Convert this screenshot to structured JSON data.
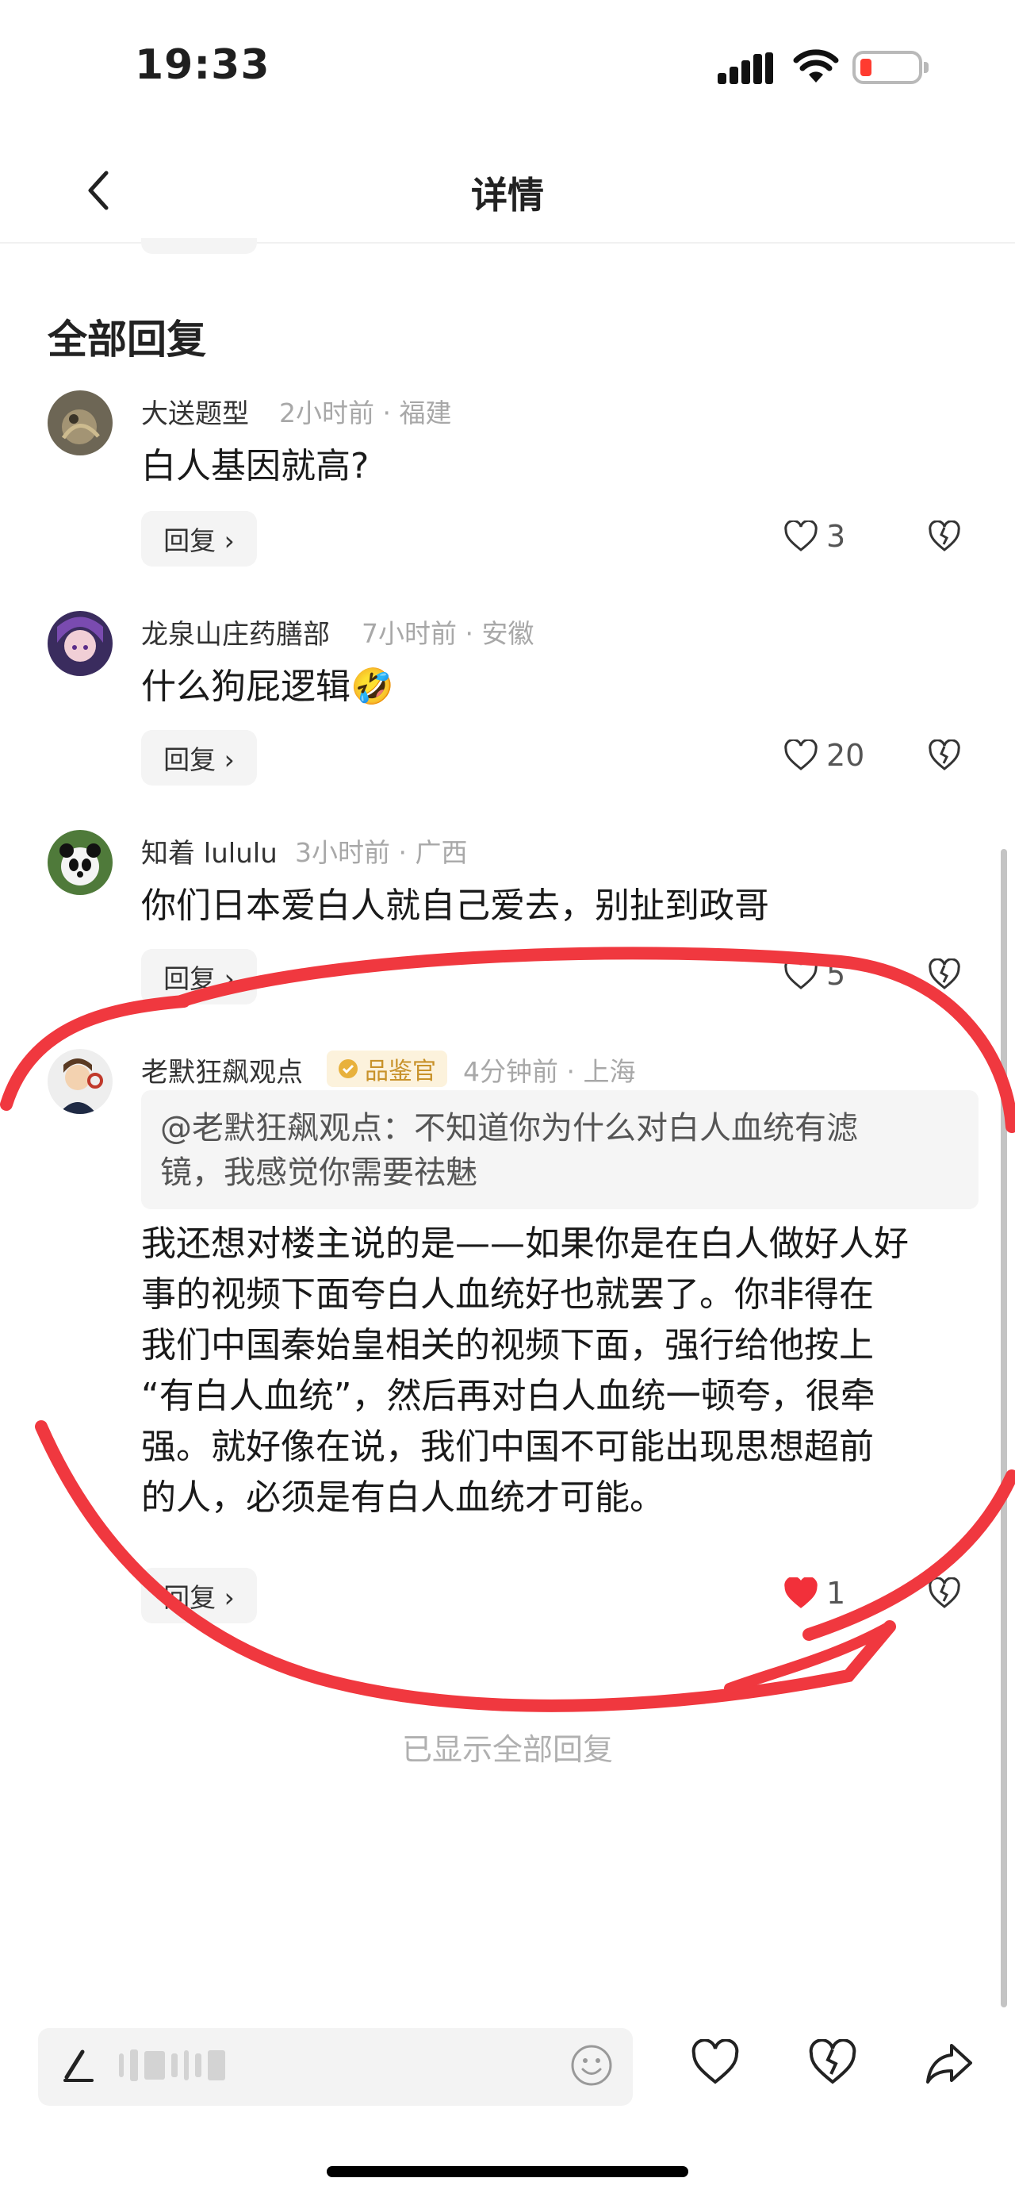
{
  "status_bar": {
    "time": "19:33"
  },
  "nav": {
    "title": "详情"
  },
  "section": {
    "title": "全部回复"
  },
  "comments": [
    {
      "username": "大送题型",
      "meta": "2小时前 · 福建",
      "text": "白人基因就高?",
      "reply_label": "回复 ›",
      "likes": "3"
    },
    {
      "username": "龙泉山庄药膳部",
      "meta": "7小时前 · 安徽",
      "text": "什么狗屁逻辑",
      "emoji": "🤣",
      "reply_label": "回复 ›",
      "likes": "20"
    },
    {
      "username": "知着 lululu",
      "meta": "3小时前 · 广西",
      "text": "你们日本爱白人就自己爱去，别扯到政哥",
      "reply_label": "回复 ›",
      "likes": "5"
    },
    {
      "username": "老默狂飙观点",
      "badge": "品鉴官",
      "meta": "4分钟前 · 上海",
      "quote_lines": [
        "@老默狂飙观点：不知道你为什么对白人血统有滤",
        "镜，我感觉你需要祛魅"
      ],
      "text_lines": [
        "我还想对楼主说的是——如果你是在白人做好人好",
        "事的视频下面夸白人血统好也就罢了。你非得在",
        "我们中国秦始皇相关的视频下面，强行给他按上",
        "“有白人血统”，然后再对白人血统一顿夸，很牵",
        "强。就好像在说，我们中国不可能出现思想超前",
        "的人，必须是有白人血统才可能。"
      ],
      "reply_label": "回复 ›",
      "likes": "1",
      "liked": true
    }
  ],
  "footer_note": "已显示全部回复",
  "colors": {
    "annotation": "#f0383f",
    "like_active": "#f2303a",
    "badge_text": "#c8922a"
  }
}
